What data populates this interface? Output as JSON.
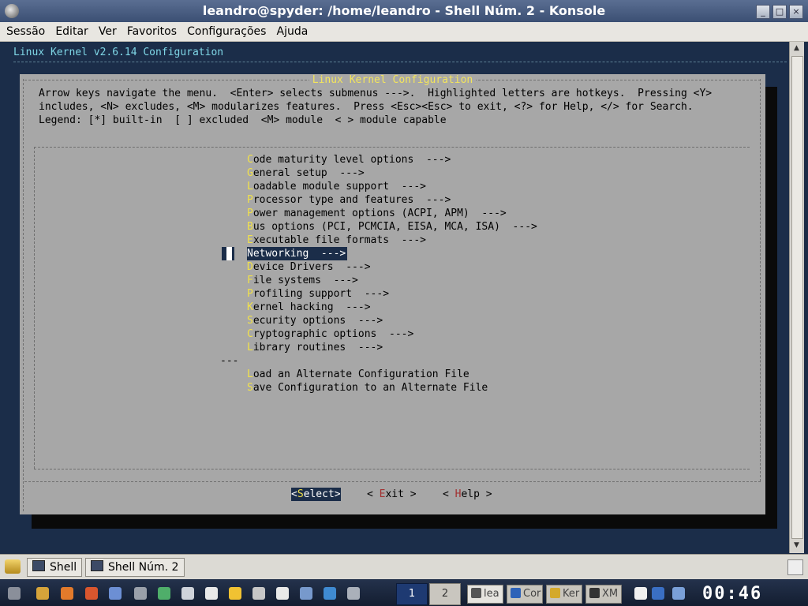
{
  "window": {
    "title": "leandro@spyder: /home/leandro - Shell Núm. 2 - Konsole",
    "minimize_glyph": "_",
    "maximize_glyph": "□",
    "close_glyph": "×"
  },
  "menubar": [
    "Sessão",
    "Editar",
    "Ver",
    "Favoritos",
    "Configurações",
    "Ajuda"
  ],
  "terminal": {
    "header": "Linux Kernel v2.6.14 Configuration",
    "dialog_title": "Linux Kernel Configuration",
    "help_lines": [
      "Arrow keys navigate the menu.  <Enter> selects submenus --->.  Highlighted letters are hotkeys.  Pressing <Y>",
      "includes, <N> excludes, <M> modularizes features.  Press <Esc><Esc> to exit, <?> for Help, </> for Search.",
      "Legend: [*] built-in  [ ] excluded  <M> module  < > module capable"
    ],
    "menu_items": [
      {
        "hot": "C",
        "rest": "ode maturity level options  --->"
      },
      {
        "hot": "G",
        "rest": "eneral setup  --->"
      },
      {
        "hot": "L",
        "rest": "oadable module support  --->"
      },
      {
        "hot": "P",
        "rest": "rocessor type and features  --->"
      },
      {
        "hot": "P",
        "rest": "ower management options (ACPI, APM)  --->"
      },
      {
        "hot": "B",
        "rest": "us options (PCI, PCMCIA, EISA, MCA, ISA)  --->"
      },
      {
        "hot": "E",
        "rest": "xecutable file formats  --->"
      },
      {
        "hot": "N",
        "rest": "etworking  --->",
        "selected": true
      },
      {
        "hot": "D",
        "rest": "evice Drivers  --->"
      },
      {
        "hot": "F",
        "rest": "ile systems  --->"
      },
      {
        "hot": "P",
        "rest": "rofiling support  --->"
      },
      {
        "hot": "K",
        "rest": "ernel hacking  --->"
      },
      {
        "hot": "S",
        "rest": "ecurity options  --->"
      },
      {
        "hot": "C",
        "rest": "ryptographic options  --->"
      },
      {
        "hot": "L",
        "rest": "ibrary routines  --->"
      }
    ],
    "separator": "---",
    "extra_items": [
      {
        "hot": "L",
        "rest": "oad an Alternate Configuration File"
      },
      {
        "hot": "S",
        "rest": "ave Configuration to an Alternate File"
      }
    ],
    "buttons": {
      "select": {
        "open": "<",
        "hot": "S",
        "rest": "elect>"
      },
      "exit": {
        "open": "< ",
        "hot": "E",
        "rest": "xit >"
      },
      "help": {
        "open": "< ",
        "hot": "H",
        "rest": "elp >"
      }
    }
  },
  "taskbar_top": {
    "tabs": [
      "Shell",
      "Shell Núm. 2"
    ]
  },
  "taskbar_bottom": {
    "pager": [
      "1",
      "2"
    ],
    "tasks": [
      "lea",
      "Cor",
      "Ker",
      "XM"
    ],
    "clock": "00:46",
    "colors": {
      "accent": "#1b2d49",
      "hotkey": "#f1e14a"
    }
  }
}
